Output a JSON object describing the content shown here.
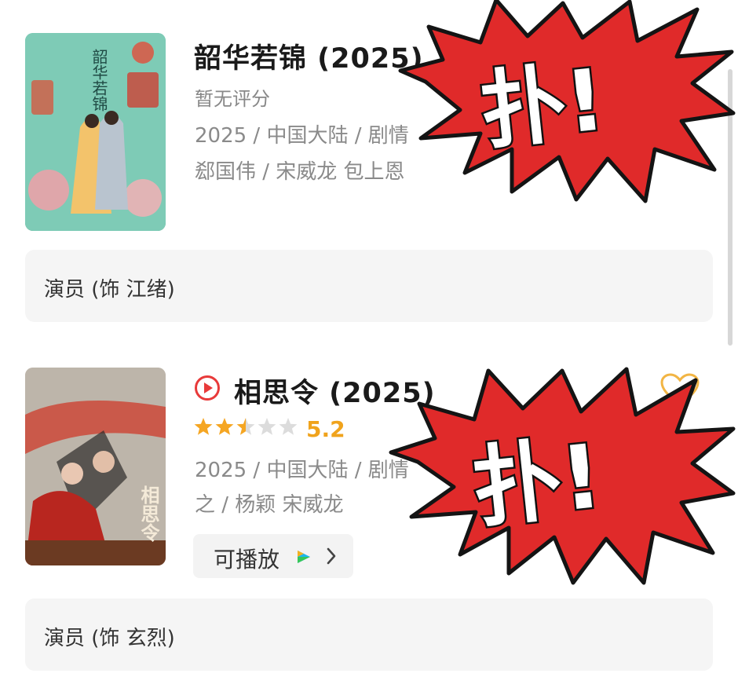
{
  "items": [
    {
      "title": "韶华若锦 (2025)",
      "rating_text": "暂无评分",
      "meta_line1": "2025 / 中国大陆 / 剧情",
      "meta_line2": "郄国伟 / 宋威龙 包上恩",
      "role": "演员 (饰 江绪)",
      "poster_title": "韶华若锦"
    },
    {
      "title": "相思令 (2025)",
      "rating_stars": 2.5,
      "rating_value": "5.2",
      "meta_line1": "2025 / 中国大陆 / 剧情",
      "meta_line2": "之 / 杨颖 宋威龙",
      "play_label": "可播放",
      "role": "演员 (饰 玄烈)",
      "poster_title": "相思令"
    }
  ],
  "stickers": [
    {
      "text": "扑!"
    },
    {
      "text": "扑!"
    }
  ],
  "colors": {
    "star": "#f5a623",
    "burst": "#e02a2a",
    "accent_play": "#e83a3a"
  },
  "icons": [
    "play-circle-icon",
    "heart-icon",
    "chevron-right-icon",
    "video-app-icon"
  ]
}
